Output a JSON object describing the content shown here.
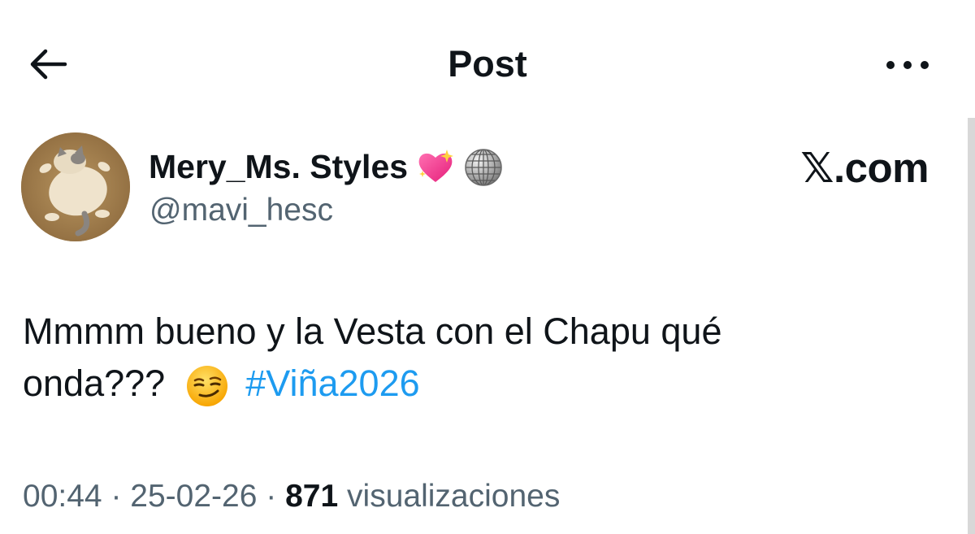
{
  "header": {
    "title": "Post",
    "back_icon": "arrow-left-icon",
    "more_icon": "more-horizontal-icon"
  },
  "author": {
    "display_name": "Mery_Ms. Styles",
    "name_emojis": [
      "sparkling-heart-icon",
      "mirror-ball-icon"
    ],
    "handle": "@mavi_hesc",
    "avatar": "cat-avatar"
  },
  "brand": {
    "label": "𝕏.com"
  },
  "tweet": {
    "line1": "Mmmm bueno y la Vesta con el Chapu qué",
    "line2_text": "onda???",
    "emoji": "smirking-face-icon",
    "hashtag": "#Viña2026"
  },
  "meta": {
    "time": "00:44",
    "sep1": "·",
    "date": "25-02-26",
    "sep2": "·",
    "views_count": "871",
    "views_label": "visualizaciones"
  },
  "colors": {
    "text": "#0f1419",
    "secondary": "#536471",
    "link": "#1d9bf0"
  }
}
